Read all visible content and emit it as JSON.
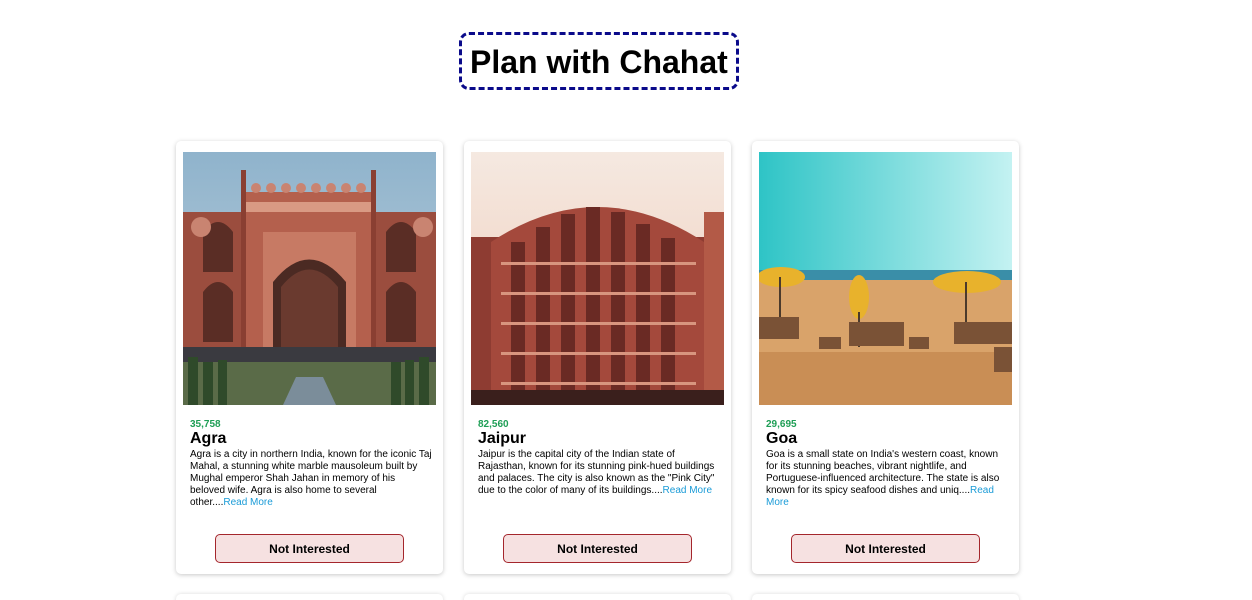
{
  "page": {
    "title": "Plan with Chahat"
  },
  "tours": [
    {
      "price": "35,758",
      "name": "Agra",
      "info": "Agra is a city in northern India, known for the iconic Taj Mahal, a stunning white marble mausoleum built by Mughal emperor Shah Jahan in memory of his beloved wife. Agra is also home to several other....",
      "read_more": "Read More",
      "button": "Not Interested",
      "image": "red-sandstone-gateway-photo"
    },
    {
      "price": "82,560",
      "name": "Jaipur",
      "info": "Jaipur is the capital city of the Indian state of Rajasthan, known for its stunning pink-hued buildings and palaces. The city is also known as the \"Pink City\" due to the color of many of its buildings....",
      "read_more": "Read More",
      "button": "Not Interested",
      "image": "hawa-mahal-palace-photo"
    },
    {
      "price": "29,695",
      "name": "Goa",
      "info": "Goa is a small state on India's western coast, known for its stunning beaches, vibrant nightlife, and Portuguese-influenced architecture. The state is also known for its spicy seafood dishes and uniq....",
      "read_more": "Read More",
      "button": "Not Interested",
      "image": "beach-umbrellas-photo"
    }
  ],
  "colors": {
    "price": "#1e9e55",
    "link": "#1a9bd7",
    "button_bg": "#f6e1e1",
    "button_border": "#a4262c",
    "title_border": "#0a0a8a"
  }
}
